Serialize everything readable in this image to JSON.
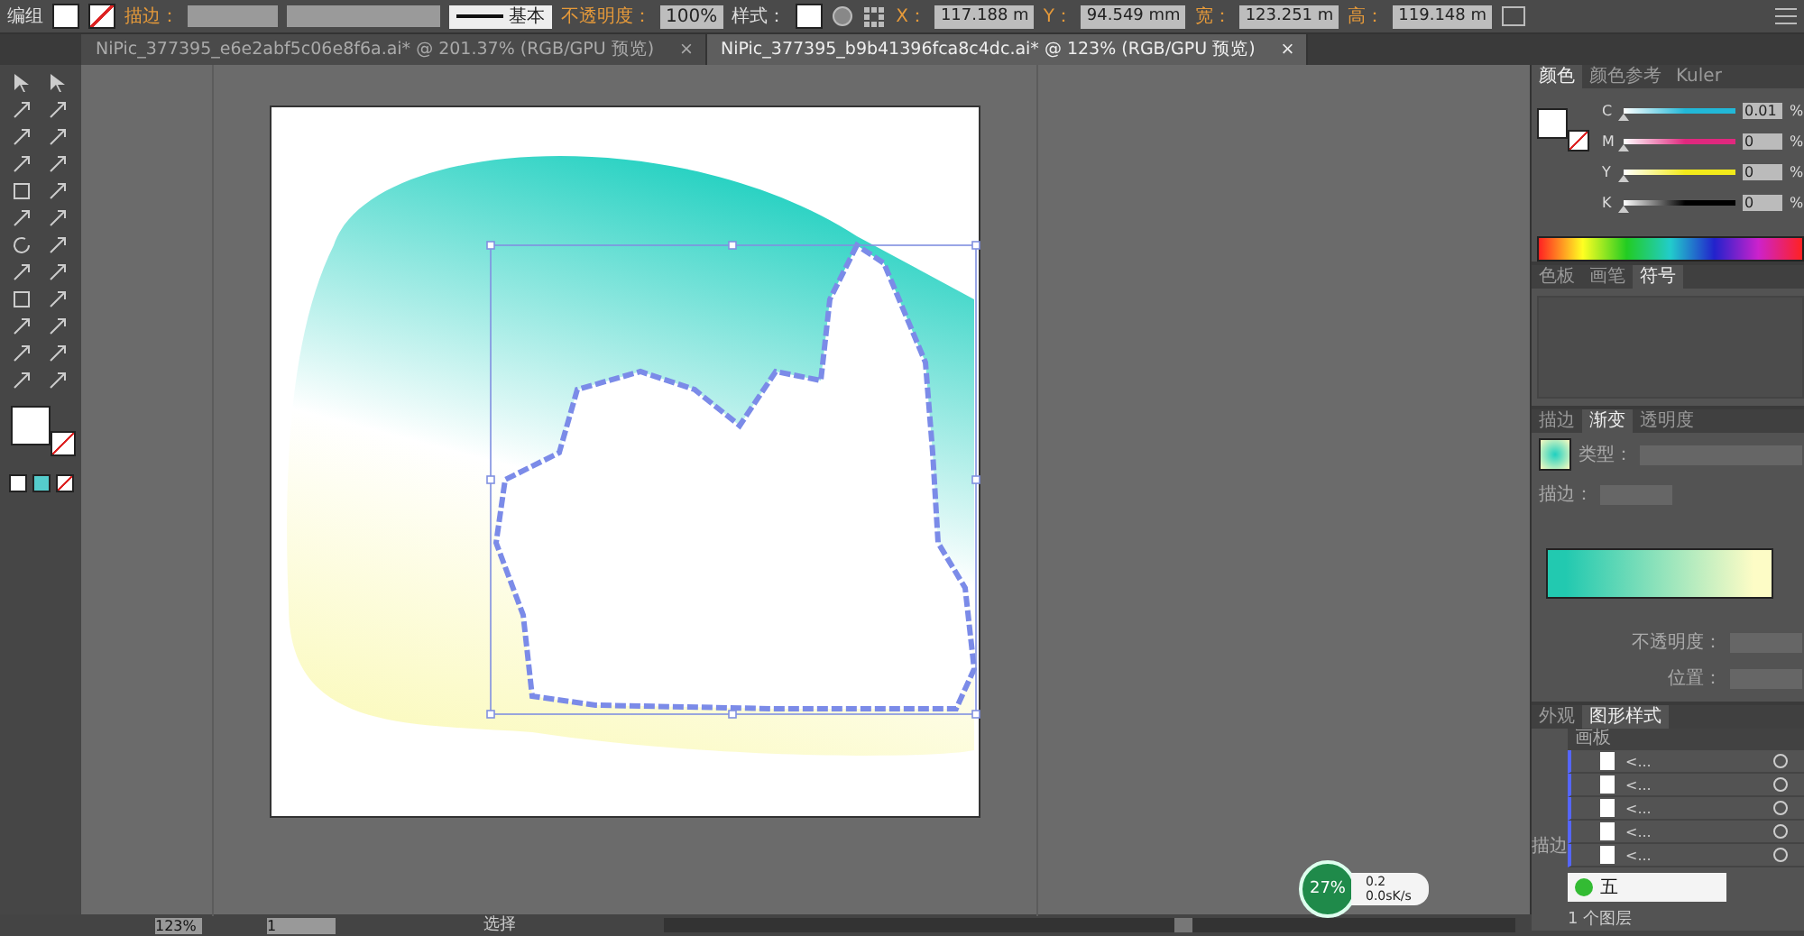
{
  "control_bar": {
    "object_label": "编组",
    "stroke_label": "描边：",
    "brush": "基本",
    "opacity_label": "不透明度：",
    "opacity": "100%",
    "style_label": "样式：",
    "transform": [
      {
        "label": "X：",
        "value": "117.188 m"
      },
      {
        "label": "Y：",
        "value": "94.549 mm"
      },
      {
        "label": "宽：",
        "value": "123.251 m"
      },
      {
        "label": "高：",
        "value": "119.148 m"
      }
    ]
  },
  "document_tabs": [
    {
      "title": "NiPic_377395_e6e2abf5c06e8f6a.ai* @ 201.37% (RGB/GPU 预览)",
      "close": "×",
      "selected": false
    },
    {
      "title": "NiPic_377395_b9b41396fca8c4dc.ai* @ 123% (RGB/GPU 预览)",
      "close": "×",
      "selected": true
    }
  ],
  "color_panel": {
    "tabs": [
      {
        "label": "颜色",
        "selected": true
      },
      {
        "label": "颜色参考",
        "selected": false
      },
      {
        "label": "Kuler",
        "selected": false
      }
    ],
    "channels": [
      {
        "name": "C",
        "value": "0.01",
        "unit": "%",
        "level": 0.0001,
        "color": "#22b8d8"
      },
      {
        "name": "M",
        "value": "0",
        "unit": "%",
        "level": 0,
        "color": "#e0287e"
      },
      {
        "name": "Y",
        "value": "0",
        "unit": "%",
        "level": 0,
        "color": "#f2ea1a"
      },
      {
        "name": "K",
        "value": "0",
        "unit": "%",
        "level": 0,
        "color": "#000000"
      }
    ]
  },
  "symbols_panel": {
    "tabs": [
      {
        "label": "色板",
        "selected": false
      },
      {
        "label": "画笔",
        "selected": false
      },
      {
        "label": "符号",
        "selected": true
      }
    ]
  },
  "gradient_panel": {
    "tabs": [
      {
        "label": "描边",
        "selected": false
      },
      {
        "label": "渐变",
        "selected": true
      },
      {
        "label": "透明度",
        "selected": false
      }
    ],
    "stops": [
      {
        "color": "#22c9b0"
      },
      {
        "color": "#fdfcc6"
      }
    ],
    "type_label": "类型：",
    "stroke_label": "描边：",
    "opacity_label": "不透明度：",
    "position_label": "位置："
  },
  "appearance_panel": {
    "tabs": [
      {
        "label": "外观",
        "selected": false
      },
      {
        "label": "图形样式",
        "selected": true
      }
    ],
    "side_label": "描边"
  },
  "layers_panel": {
    "tab": "画板",
    "rows": [
      {
        "name": "<..."
      },
      {
        "name": "<..."
      },
      {
        "name": "<..."
      },
      {
        "name": "<..."
      },
      {
        "name": "<..."
      }
    ],
    "footer": "1 个图层"
  },
  "status_bar": {
    "zoom": "123%",
    "page": "1",
    "mode": "选择"
  },
  "network_widget": {
    "percent": "27%",
    "upload": "0.2",
    "download": "0.0sK/s"
  },
  "ime_bar": {
    "mode": "五"
  }
}
